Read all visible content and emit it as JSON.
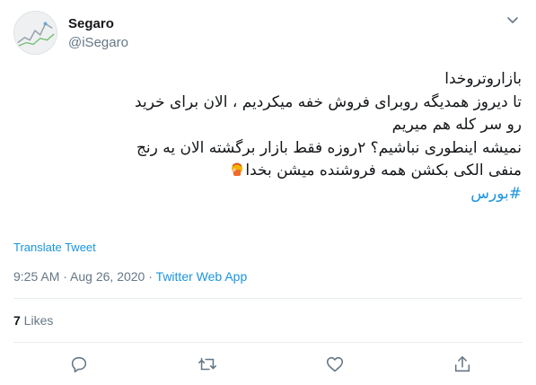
{
  "author": {
    "name": "Segaro",
    "handle": "@iSegaro"
  },
  "tweet": {
    "lines": [
      "بازاروتروخدا",
      "تا دیروز همدیگه روبرای فروش خفه میکردیم ، الان برای خرید",
      "رو سر کله هم میریم",
      "نمیشه اینطوری نباشیم؟ ۲روزه فقط بازار برگشته الان یه رنج",
      "منفی الکی بکشن همه فروشنده میشن بخدا"
    ],
    "emoji": "facepalm-emoji",
    "hashtag": "#بورس"
  },
  "translate_label": "Translate Tweet",
  "meta": {
    "time": "9:25 AM",
    "separator": " · ",
    "date": "Aug 26, 2020",
    "source": "Twitter Web App"
  },
  "stats": {
    "likes_count": "7",
    "likes_label": " Likes"
  },
  "icons": {
    "caret": "chevron-down-icon",
    "reply": "reply-icon",
    "retweet": "retweet-icon",
    "like": "heart-icon",
    "share": "share-icon"
  },
  "colors": {
    "link": "#1b95e0",
    "secondary": "#657786",
    "divider": "#e6ecf0"
  }
}
